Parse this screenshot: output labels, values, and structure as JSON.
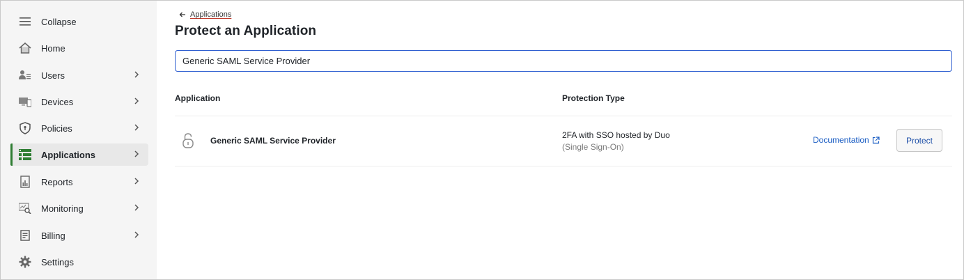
{
  "sidebar": {
    "items": [
      {
        "label": "Collapse",
        "icon": "hamburger-icon",
        "chevron": false
      },
      {
        "label": "Home",
        "icon": "home-icon",
        "chevron": false
      },
      {
        "label": "Users",
        "icon": "users-icon",
        "chevron": true
      },
      {
        "label": "Devices",
        "icon": "devices-icon",
        "chevron": true
      },
      {
        "label": "Policies",
        "icon": "shield-icon",
        "chevron": true
      },
      {
        "label": "Applications",
        "icon": "applications-icon",
        "chevron": true,
        "active": true
      },
      {
        "label": "Reports",
        "icon": "reports-icon",
        "chevron": true
      },
      {
        "label": "Monitoring",
        "icon": "monitoring-icon",
        "chevron": true
      },
      {
        "label": "Billing",
        "icon": "billing-icon",
        "chevron": true
      },
      {
        "label": "Settings",
        "icon": "gear-icon",
        "chevron": false
      }
    ]
  },
  "breadcrumb": {
    "label": "Applications"
  },
  "page": {
    "title": "Protect an Application"
  },
  "search": {
    "value": "Generic SAML Service Provider"
  },
  "table": {
    "headers": {
      "application": "Application",
      "protection": "Protection Type"
    },
    "rows": [
      {
        "icon": "lock-icon",
        "name": "Generic SAML Service Provider",
        "protection_line1": "2FA with SSO hosted by Duo",
        "protection_line2": "(Single Sign-On)",
        "doc_label": "Documentation",
        "action_label": "Protect"
      }
    ]
  },
  "colors": {
    "accent": "#2e7d32",
    "link": "#1d5fc4",
    "focus": "#2f5fd0"
  }
}
